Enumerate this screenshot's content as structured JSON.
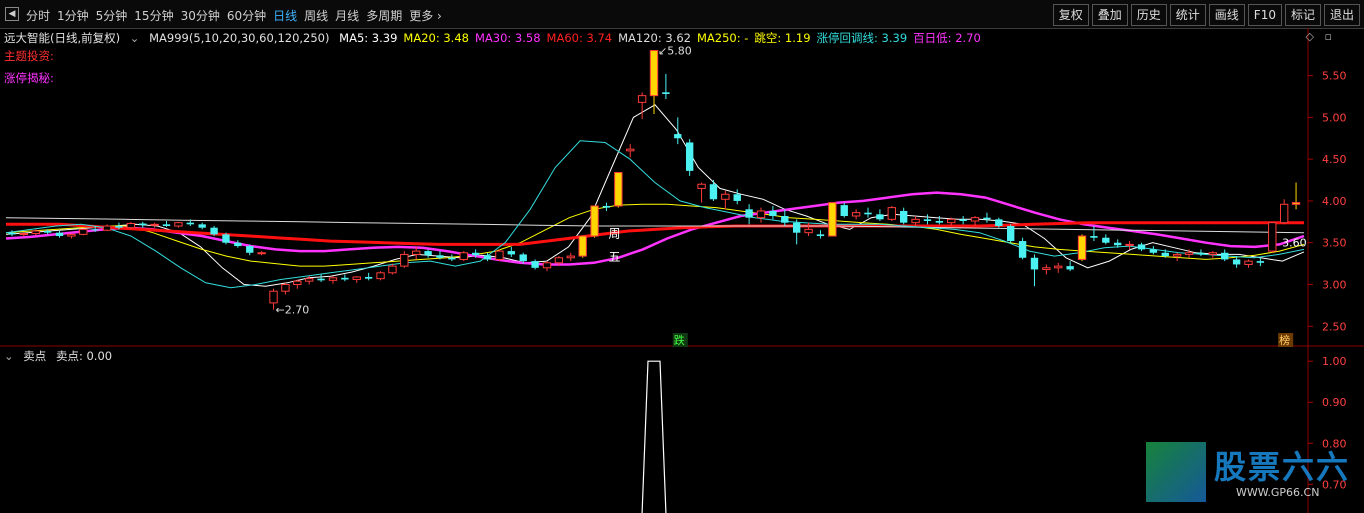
{
  "toolbar": {
    "periods": [
      "分时",
      "1分钟",
      "5分钟",
      "15分钟",
      "30分钟",
      "60分钟",
      "日线",
      "周线",
      "月线",
      "多周期",
      "更多"
    ],
    "active_period": "日线",
    "tools": [
      "复权",
      "叠加",
      "历史",
      "统计",
      "画线",
      "F10",
      "标记",
      "退出"
    ]
  },
  "header": {
    "stock_name": "远大智能(日线,前复权)",
    "indicator_params": "MA999(5,10,20,30,60,120,250)",
    "ma_values": [
      {
        "label": "MA5:",
        "value": "3.39",
        "color": "#ffffff"
      },
      {
        "label": "MA20:",
        "value": "3.48",
        "color": "#ffff00"
      },
      {
        "label": "MA30:",
        "value": "3.58",
        "color": "#ff33ff"
      },
      {
        "label": "MA60:",
        "value": "3.74",
        "color": "#ff2020"
      },
      {
        "label": "MA120:",
        "value": "3.62",
        "color": "#dddddd"
      },
      {
        "label": "MA250:",
        "value": "-",
        "color": "#ffff00"
      },
      {
        "label": "跳空:",
        "value": "1.19",
        "color": "#ffff00"
      },
      {
        "label": "涨停回调线:",
        "value": "3.39",
        "color": "#33dddd"
      },
      {
        "label": "百日低:",
        "value": "2.70",
        "color": "#ff33ff"
      }
    ],
    "line2": "主题投资:",
    "line3": "涨停揭秘:"
  },
  "sub_panel": {
    "title": "卖点",
    "value_label": "卖点: 0.00"
  },
  "markers": {
    "high_label": "5.80",
    "low_label": "2.70",
    "last_label": "3.60",
    "zhou": "周",
    "wu": "五",
    "die": "跌",
    "bang": "榜"
  },
  "watermark": {
    "brand": "股票六六",
    "url": "WWW.GP66.CN"
  },
  "colors": {
    "up": "#ff3b3b",
    "down": "#4cf2f2",
    "limit": "#ffd700",
    "ma60": "#ff1010",
    "ma30": "#ff33ff"
  },
  "chart_data": {
    "type": "candlestick",
    "y_axis_main": {
      "ticks": [
        2.5,
        3.0,
        3.5,
        4.0,
        4.5,
        5.0,
        5.5
      ],
      "range": [
        2.3,
        5.95
      ]
    },
    "y_axis_sub": {
      "ticks": [
        0.7,
        0.8,
        0.9,
        1.0
      ],
      "range": [
        0.63,
        1.02
      ]
    },
    "candles": [
      [
        3.62,
        3.65,
        3.58,
        3.6
      ],
      [
        3.6,
        3.63,
        3.57,
        3.61
      ],
      [
        3.61,
        3.66,
        3.59,
        3.64
      ],
      [
        3.64,
        3.66,
        3.6,
        3.62
      ],
      [
        3.62,
        3.64,
        3.56,
        3.58
      ],
      [
        3.58,
        3.61,
        3.55,
        3.6
      ],
      [
        3.6,
        3.67,
        3.59,
        3.66
      ],
      [
        3.66,
        3.7,
        3.63,
        3.65
      ],
      [
        3.65,
        3.72,
        3.64,
        3.7
      ],
      [
        3.7,
        3.74,
        3.66,
        3.68
      ],
      [
        3.68,
        3.75,
        3.66,
        3.73
      ],
      [
        3.73,
        3.75,
        3.68,
        3.71
      ],
      [
        3.71,
        3.74,
        3.68,
        3.72
      ],
      [
        3.72,
        3.76,
        3.69,
        3.7
      ],
      [
        3.7,
        3.75,
        3.68,
        3.74
      ],
      [
        3.74,
        3.78,
        3.7,
        3.72
      ],
      [
        3.72,
        3.74,
        3.66,
        3.68
      ],
      [
        3.68,
        3.7,
        3.58,
        3.6
      ],
      [
        3.6,
        3.62,
        3.48,
        3.5
      ],
      [
        3.5,
        3.53,
        3.44,
        3.46
      ],
      [
        3.46,
        3.48,
        3.35,
        3.38
      ],
      [
        3.38,
        3.4,
        3.35,
        3.38
      ],
      [
        2.78,
        2.95,
        2.7,
        2.92
      ],
      [
        2.92,
        3.02,
        2.88,
        3.0
      ],
      [
        3.0,
        3.06,
        2.95,
        3.04
      ],
      [
        3.04,
        3.1,
        3.0,
        3.07
      ],
      [
        3.07,
        3.12,
        3.03,
        3.05
      ],
      [
        3.05,
        3.1,
        3.01,
        3.08
      ],
      [
        3.08,
        3.12,
        3.04,
        3.06
      ],
      [
        3.06,
        3.1,
        3.02,
        3.09
      ],
      [
        3.09,
        3.14,
        3.05,
        3.07
      ],
      [
        3.07,
        3.16,
        3.05,
        3.14
      ],
      [
        3.14,
        3.25,
        3.12,
        3.22
      ],
      [
        3.22,
        3.4,
        3.2,
        3.36
      ],
      [
        3.36,
        3.45,
        3.3,
        3.4
      ],
      [
        3.4,
        3.42,
        3.32,
        3.35
      ],
      [
        3.35,
        3.4,
        3.3,
        3.32
      ],
      [
        3.32,
        3.36,
        3.28,
        3.3
      ],
      [
        3.3,
        3.4,
        3.28,
        3.38
      ],
      [
        3.38,
        3.42,
        3.32,
        3.35
      ],
      [
        3.35,
        3.38,
        3.28,
        3.3
      ],
      [
        3.3,
        3.42,
        3.28,
        3.4
      ],
      [
        3.4,
        3.45,
        3.33,
        3.36
      ],
      [
        3.36,
        3.38,
        3.25,
        3.28
      ],
      [
        3.28,
        3.3,
        3.18,
        3.2
      ],
      [
        3.2,
        3.28,
        3.16,
        3.26
      ],
      [
        3.26,
        3.34,
        3.22,
        3.32
      ],
      [
        3.32,
        3.38,
        3.28,
        3.34
      ],
      [
        3.34,
        3.58,
        3.32,
        3.58
      ],
      [
        3.58,
        3.94,
        3.56,
        3.94
      ],
      [
        3.94,
        3.98,
        3.88,
        3.92
      ],
      [
        3.94,
        4.34,
        3.92,
        4.34
      ],
      [
        4.6,
        4.68,
        4.52,
        4.62
      ],
      [
        5.18,
        5.3,
        4.98,
        5.26
      ],
      [
        5.26,
        5.8,
        5.04,
        5.8
      ],
      [
        5.3,
        5.52,
        5.22,
        5.28
      ],
      [
        4.8,
        5.0,
        4.68,
        4.75
      ],
      [
        4.7,
        4.74,
        4.3,
        4.36
      ],
      [
        4.15,
        4.22,
        3.98,
        4.2
      ],
      [
        4.2,
        4.25,
        4.0,
        4.02
      ],
      [
        4.02,
        4.12,
        3.9,
        4.08
      ],
      [
        4.08,
        4.14,
        3.96,
        4.0
      ],
      [
        3.9,
        3.96,
        3.72,
        3.8
      ],
      [
        3.8,
        3.92,
        3.74,
        3.88
      ],
      [
        3.88,
        3.94,
        3.78,
        3.82
      ],
      [
        3.82,
        3.9,
        3.7,
        3.74
      ],
      [
        3.74,
        3.78,
        3.48,
        3.62
      ],
      [
        3.62,
        3.74,
        3.58,
        3.66
      ],
      [
        3.6,
        3.65,
        3.55,
        3.58
      ],
      [
        3.58,
        3.98,
        3.58,
        3.98
      ],
      [
        3.95,
        3.98,
        3.8,
        3.82
      ],
      [
        3.82,
        3.9,
        3.78,
        3.86
      ],
      [
        3.86,
        3.92,
        3.8,
        3.84
      ],
      [
        3.84,
        3.9,
        3.76,
        3.78
      ],
      [
        3.78,
        3.94,
        3.76,
        3.92
      ],
      [
        3.88,
        3.92,
        3.72,
        3.74
      ],
      [
        3.74,
        3.82,
        3.7,
        3.78
      ],
      [
        3.78,
        3.84,
        3.72,
        3.76
      ],
      [
        3.76,
        3.82,
        3.72,
        3.74
      ],
      [
        3.74,
        3.8,
        3.7,
        3.78
      ],
      [
        3.78,
        3.82,
        3.72,
        3.76
      ],
      [
        3.76,
        3.82,
        3.7,
        3.8
      ],
      [
        3.8,
        3.86,
        3.74,
        3.78
      ],
      [
        3.78,
        3.8,
        3.68,
        3.7
      ],
      [
        3.7,
        3.72,
        3.5,
        3.52
      ],
      [
        3.52,
        3.56,
        3.3,
        3.32
      ],
      [
        3.32,
        3.36,
        2.98,
        3.18
      ],
      [
        3.18,
        3.24,
        3.12,
        3.2
      ],
      [
        3.2,
        3.26,
        3.14,
        3.22
      ],
      [
        3.22,
        3.28,
        3.16,
        3.18
      ],
      [
        3.3,
        3.6,
        3.28,
        3.58
      ],
      [
        3.58,
        3.7,
        3.52,
        3.56
      ],
      [
        3.56,
        3.6,
        3.48,
        3.5
      ],
      [
        3.5,
        3.54,
        3.44,
        3.47
      ],
      [
        3.47,
        3.52,
        3.42,
        3.48
      ],
      [
        3.48,
        3.5,
        3.4,
        3.42
      ],
      [
        3.42,
        3.46,
        3.36,
        3.38
      ],
      [
        3.38,
        3.42,
        3.32,
        3.34
      ],
      [
        3.34,
        3.38,
        3.28,
        3.36
      ],
      [
        3.36,
        3.42,
        3.32,
        3.38
      ],
      [
        3.38,
        3.42,
        3.34,
        3.36
      ],
      [
        3.36,
        3.4,
        3.32,
        3.38
      ],
      [
        3.38,
        3.42,
        3.28,
        3.3
      ],
      [
        3.3,
        3.34,
        3.2,
        3.24
      ],
      [
        3.24,
        3.3,
        3.2,
        3.28
      ],
      [
        3.28,
        3.32,
        3.22,
        3.26
      ],
      [
        3.4,
        3.74,
        3.38,
        3.74
      ],
      [
        3.74,
        4.02,
        3.72,
        3.96
      ],
      [
        3.96,
        4.22,
        3.9,
        3.98
      ]
    ],
    "limit_up_days": [
      48,
      49,
      51,
      54,
      69,
      90,
      108,
      109
    ],
    "ma_lines": {
      "ma5": {
        "color": "#ffffff",
        "values": [
          3.6,
          3.62,
          3.64,
          3.66,
          3.68,
          3.7,
          3.72,
          3.7,
          3.62,
          3.45,
          3.2,
          3.0,
          2.98,
          3.02,
          3.08,
          3.1,
          3.15,
          3.22,
          3.3,
          3.36,
          3.34,
          3.32,
          3.35,
          3.32,
          3.26,
          3.28,
          3.45,
          3.8,
          4.4,
          5.0,
          5.15,
          4.85,
          4.4,
          4.15,
          4.08,
          4.02,
          3.9,
          3.82,
          3.72,
          3.66,
          3.8,
          3.84,
          3.82,
          3.8,
          3.78,
          3.78,
          3.76,
          3.72,
          3.55,
          3.32,
          3.2,
          3.28,
          3.42,
          3.5,
          3.44,
          3.38,
          3.36,
          3.36,
          3.32,
          3.28,
          3.39
        ]
      },
      "ma20": {
        "color": "#ffff00",
        "values": [
          3.62,
          3.64,
          3.66,
          3.68,
          3.7,
          3.7,
          3.62,
          3.52,
          3.42,
          3.34,
          3.28,
          3.25,
          3.22,
          3.22,
          3.24,
          3.26,
          3.28,
          3.3,
          3.32,
          3.35,
          3.4,
          3.5,
          3.65,
          3.8,
          3.9,
          3.95,
          3.96,
          3.96,
          3.94,
          3.92,
          3.88,
          3.84,
          3.8,
          3.78,
          3.76,
          3.74,
          3.72,
          3.7,
          3.66,
          3.6,
          3.55,
          3.5,
          3.45,
          3.42,
          3.4,
          3.38,
          3.36,
          3.34,
          3.32,
          3.3,
          3.32,
          3.35,
          3.4,
          3.48
        ]
      },
      "ma30": {
        "color": "#ff33ff",
        "values": [
          3.55,
          3.57,
          3.6,
          3.63,
          3.66,
          3.68,
          3.66,
          3.62,
          3.58,
          3.52,
          3.46,
          3.42,
          3.4,
          3.4,
          3.42,
          3.44,
          3.45,
          3.44,
          3.4,
          3.35,
          3.3,
          3.26,
          3.24,
          3.24,
          3.26,
          3.32,
          3.42,
          3.55,
          3.66,
          3.74,
          3.82,
          3.86,
          3.9,
          3.94,
          3.98,
          4.0,
          4.04,
          4.08,
          4.1,
          4.08,
          4.04,
          3.95,
          3.86,
          3.78,
          3.72,
          3.68,
          3.64,
          3.6,
          3.55,
          3.5,
          3.46,
          3.45,
          3.48,
          3.58
        ]
      },
      "ma60": {
        "color": "#ff1010",
        "values": [
          3.72,
          3.72,
          3.72,
          3.7,
          3.68,
          3.66,
          3.64,
          3.62,
          3.6,
          3.58,
          3.56,
          3.54,
          3.52,
          3.51,
          3.5,
          3.49,
          3.48,
          3.48,
          3.48,
          3.48,
          3.52,
          3.56,
          3.6,
          3.64,
          3.66,
          3.68,
          3.69,
          3.7,
          3.7,
          3.7,
          3.7,
          3.7,
          3.7,
          3.7,
          3.7,
          3.7,
          3.7,
          3.71,
          3.72,
          3.73,
          3.74,
          3.74,
          3.74,
          3.74,
          3.74,
          3.74,
          3.74,
          3.74,
          3.74
        ]
      },
      "ma120": {
        "color": "#dddddd",
        "values": [
          3.8,
          3.79,
          3.78,
          3.77,
          3.76,
          3.75,
          3.74,
          3.73,
          3.72,
          3.71,
          3.7,
          3.7,
          3.7,
          3.7,
          3.7,
          3.69,
          3.68,
          3.67,
          3.66,
          3.65,
          3.64,
          3.63,
          3.62
        ]
      },
      "ztlines": {
        "color": "#33dddd",
        "values": [
          3.62,
          3.66,
          3.7,
          3.72,
          3.68,
          3.58,
          3.4,
          3.2,
          3.02,
          2.96,
          3.0,
          3.06,
          3.1,
          3.14,
          3.18,
          3.22,
          3.26,
          3.28,
          3.22,
          3.28,
          3.5,
          3.9,
          4.4,
          4.72,
          4.7,
          4.5,
          4.22,
          4.0,
          3.92,
          3.86,
          3.8,
          3.76,
          3.74,
          3.72,
          3.72,
          3.72,
          3.7,
          3.68,
          3.66,
          3.62,
          3.52,
          3.4,
          3.34,
          3.38,
          3.44,
          3.46,
          3.42,
          3.38,
          3.36,
          3.34,
          3.32,
          3.36,
          3.42
        ]
      }
    },
    "sell_signal": {
      "index": 54,
      "value": 1.0
    }
  }
}
